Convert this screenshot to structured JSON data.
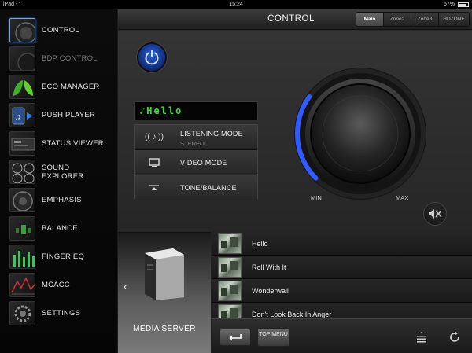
{
  "status_bar": {
    "carrier": "iPad",
    "time": "15:24",
    "battery": "67%"
  },
  "sidebar": {
    "items": [
      {
        "label": "CONTROL",
        "icon": "control-icon",
        "state": "active"
      },
      {
        "label": "BDP CONTROL",
        "icon": "bdp-control-icon",
        "state": "disabled"
      },
      {
        "label": "ECO MANAGER",
        "icon": "eco-leaf-icon",
        "state": "normal"
      },
      {
        "label": "PUSH PLAYER",
        "icon": "push-player-icon",
        "state": "normal"
      },
      {
        "label": "STATUS VIEWER",
        "icon": "status-viewer-icon",
        "state": "normal"
      },
      {
        "label": "SOUND EXPLORER",
        "icon": "sound-explorer-icon",
        "state": "normal"
      },
      {
        "label": "EMPHASIS",
        "icon": "emphasis-icon",
        "state": "normal"
      },
      {
        "label": "BALANCE",
        "icon": "balance-icon",
        "state": "normal"
      },
      {
        "label": "FINGER EQ",
        "icon": "finger-eq-icon",
        "state": "normal"
      },
      {
        "label": "MCACC",
        "icon": "mcacc-icon",
        "state": "normal"
      },
      {
        "label": "SETTINGS",
        "icon": "settings-icon",
        "state": "normal"
      }
    ]
  },
  "header": {
    "title": "CONTROL",
    "zones": [
      {
        "label": "Main",
        "active": true
      },
      {
        "label": "Zone2",
        "active": false
      },
      {
        "label": "Zone3",
        "active": false
      },
      {
        "label": "HDZONE",
        "active": false
      }
    ]
  },
  "control": {
    "display_text": "♪Hello",
    "modes": [
      {
        "label": "LISTENING MODE",
        "sub": "STEREO",
        "icon": "listening-mode-icon"
      },
      {
        "label": "VIDEO MODE",
        "icon": "monitor-icon"
      },
      {
        "label": "TONE/BALANCE",
        "icon": "tone-balance-icon"
      }
    ],
    "volume": {
      "min_label": "MIN",
      "max_label": "MAX",
      "level_fraction": 0.3
    },
    "accent_color": "#2f5bff",
    "display_color": "#32e03a"
  },
  "media": {
    "source_label": "MEDIA SERVER",
    "tracks": [
      "Hello",
      "Roll With It",
      "Wonderwall",
      "Don't Look Back In Anger"
    ],
    "top_menu_label": "TOP MENU"
  }
}
